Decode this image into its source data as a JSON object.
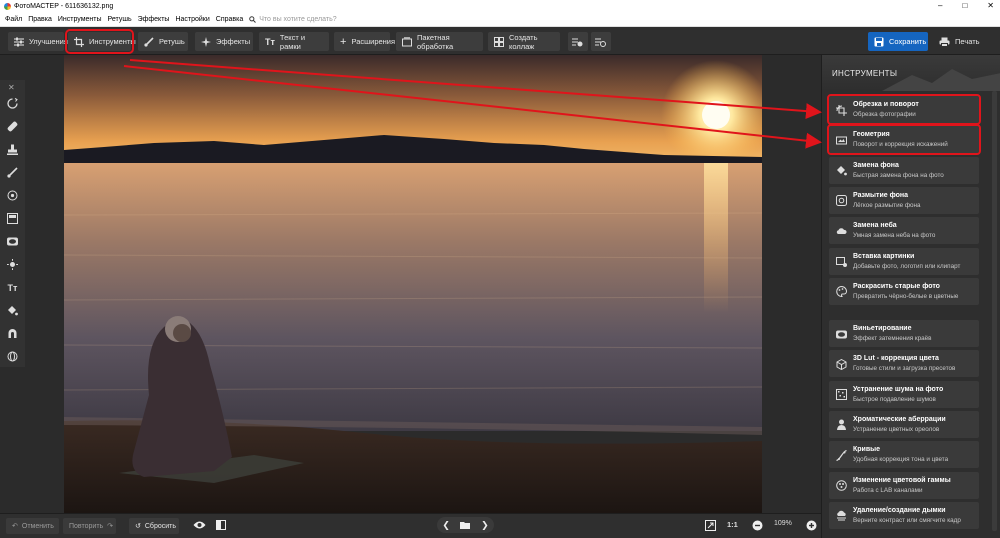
{
  "window": {
    "title": "ФотоМАСТЕР - 611636132.png"
  },
  "menu": {
    "items": [
      "Файл",
      "Правка",
      "Инструменты",
      "Ретушь",
      "Эффекты",
      "Настройки",
      "Справка"
    ],
    "search_placeholder": "Что вы хотите сделать?"
  },
  "toolbar": {
    "tabs": [
      {
        "label": "Улучшения",
        "icon": "sliders-icon"
      },
      {
        "label": "Инструменты",
        "icon": "crop-icon"
      },
      {
        "label": "Ретушь",
        "icon": "brush-icon"
      },
      {
        "label": "Эффекты",
        "icon": "sparkle-icon"
      },
      {
        "label": "Текст и рамки",
        "icon": "text-icon"
      },
      {
        "label": "Расширения",
        "icon": "plus-icon"
      }
    ],
    "batch_label": "Пакетная обработка",
    "collage_label": "Создать коллаж",
    "save_label": "Сохранить",
    "print_label": "Печать"
  },
  "panel": {
    "title": "ИНСТРУМЕНТЫ",
    "tools": [
      {
        "title": "Обрезка и поворот",
        "subtitle": "Обрезка фотографии",
        "icon": "crop-rotate-icon"
      },
      {
        "title": "Геометрия",
        "subtitle": "Поворот и коррекция искажений",
        "icon": "geometry-icon"
      },
      {
        "title": "Замена фона",
        "subtitle": "Быстрая замена фона на фото",
        "icon": "bucket-icon"
      },
      {
        "title": "Размытие фона",
        "subtitle": "Лёгкое размытие фона",
        "icon": "blur-icon"
      },
      {
        "title": "Замена неба",
        "subtitle": "Умная замена неба на фото",
        "icon": "cloud-icon"
      },
      {
        "title": "Вставка картинки",
        "subtitle": "Добавьте фото, логотип или клипарт",
        "icon": "insert-image-icon"
      },
      {
        "title": "Раскрасить старые фото",
        "subtitle": "Превратить чёрно-белые в цветные",
        "icon": "palette-icon"
      }
    ],
    "effects": [
      {
        "title": "Виньетирование",
        "subtitle": "Эффект затемнения краёв",
        "icon": "vignette-icon"
      },
      {
        "title": "3D Lut - коррекция цвета",
        "subtitle": "Готовые стили и загрузка пресетов",
        "icon": "cube-icon"
      },
      {
        "title": "Устранение шума на фото",
        "subtitle": "Быстрое подавление шумов",
        "icon": "noise-icon"
      },
      {
        "title": "Хроматические аберрации",
        "subtitle": "Устранение цветных ореолов",
        "icon": "aberration-icon"
      },
      {
        "title": "Кривые",
        "subtitle": "Удобная коррекция тона и цвета",
        "icon": "curves-icon"
      },
      {
        "title": "Изменение цветовой гаммы",
        "subtitle": "Работа с LAB каналами",
        "icon": "color-gamut-icon"
      },
      {
        "title": "Удаление/создание дымки",
        "subtitle": "Верните контраст или смягчите кадр",
        "icon": "haze-icon"
      }
    ]
  },
  "bottom": {
    "undo_label": "Отменить",
    "redo_label": "Повторить",
    "reset_label": "Сбросить",
    "ratio_label": "1:1",
    "zoom_value": "109%"
  },
  "colors": {
    "accent": "#1565c0",
    "highlight": "#e0141b",
    "panel_bg": "#2e2e2e",
    "card_bg": "#3a3a3a"
  }
}
